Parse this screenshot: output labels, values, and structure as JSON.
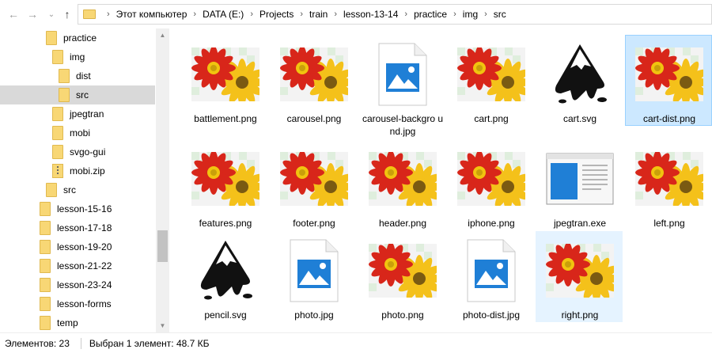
{
  "address": {
    "crumbs": [
      "Этот компьютер",
      "DATA (E:)",
      "Projects",
      "train",
      "lesson-13-14",
      "practice",
      "img",
      "src"
    ]
  },
  "sidebar": {
    "items": [
      {
        "label": "practice",
        "indent": 2,
        "type": "folder"
      },
      {
        "label": "img",
        "indent": 3,
        "type": "folder"
      },
      {
        "label": "dist",
        "indent": 4,
        "type": "folder"
      },
      {
        "label": "src",
        "indent": 4,
        "type": "folder",
        "selected": true
      },
      {
        "label": "jpegtran",
        "indent": 3,
        "type": "folder"
      },
      {
        "label": "mobi",
        "indent": 3,
        "type": "folder"
      },
      {
        "label": "svgo-gui",
        "indent": 3,
        "type": "folder"
      },
      {
        "label": "mobi.zip",
        "indent": 3,
        "type": "zip"
      },
      {
        "label": "src",
        "indent": 2,
        "type": "folder"
      },
      {
        "label": "lesson-15-16",
        "indent": 1,
        "type": "folder"
      },
      {
        "label": "lesson-17-18",
        "indent": 1,
        "type": "folder"
      },
      {
        "label": "lesson-19-20",
        "indent": 1,
        "type": "folder"
      },
      {
        "label": "lesson-21-22",
        "indent": 1,
        "type": "folder"
      },
      {
        "label": "lesson-23-24",
        "indent": 1,
        "type": "folder"
      },
      {
        "label": "lesson-forms",
        "indent": 1,
        "type": "folder"
      },
      {
        "label": "temp",
        "indent": 1,
        "type": "folder"
      }
    ]
  },
  "files": [
    {
      "name": "battlement.png",
      "kind": "flower-icon"
    },
    {
      "name": "carousel.png",
      "kind": "flower-icon"
    },
    {
      "name": "carousel-backgro und.jpg",
      "kind": "photo-icon"
    },
    {
      "name": "cart.png",
      "kind": "flower-icon"
    },
    {
      "name": "cart.svg",
      "kind": "inkscape-icon"
    },
    {
      "name": "cart-dist.png",
      "kind": "flower-icon",
      "state": "selected"
    },
    {
      "name": "features.png",
      "kind": "flower-icon"
    },
    {
      "name": "footer.png",
      "kind": "flower-icon"
    },
    {
      "name": "header.png",
      "kind": "flower-icon"
    },
    {
      "name": "iphone.png",
      "kind": "flower-icon"
    },
    {
      "name": "jpegtran.exe",
      "kind": "exe-icon"
    },
    {
      "name": "left.png",
      "kind": "flower-icon"
    },
    {
      "name": "pencil.svg",
      "kind": "inkscape-icon"
    },
    {
      "name": "photo.jpg",
      "kind": "photo-icon"
    },
    {
      "name": "photo.png",
      "kind": "flower-icon"
    },
    {
      "name": "photo-dist.jpg",
      "kind": "photo-icon"
    },
    {
      "name": "right.png",
      "kind": "flower-icon",
      "state": "hovered"
    }
  ],
  "status": {
    "count": "Элементов: 23",
    "selection": "Выбран 1 элемент: 48.7 КБ"
  },
  "colors": {
    "selected_bg": "#cce8ff",
    "hover_bg": "#e5f3ff",
    "folder": "#f8d775",
    "accent_blue": "#1f7fd6"
  }
}
